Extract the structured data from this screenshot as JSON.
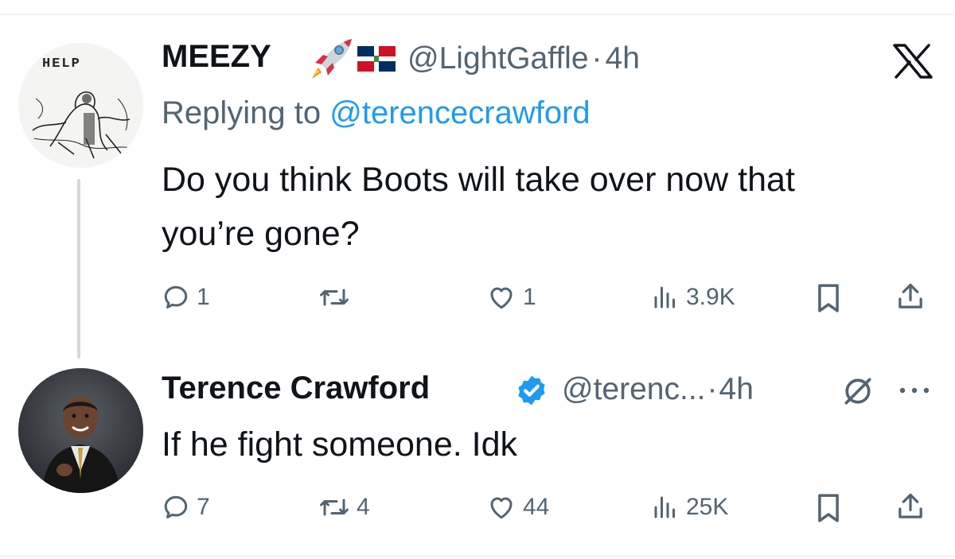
{
  "tweet1": {
    "avatar_text": "HELP",
    "display_name": "MEEZY",
    "handle": "@LightGaffle",
    "sep": "·",
    "time": "4h",
    "emoji_1": "rocket",
    "emoji_2": "dominican-flag",
    "replying_prefix": "Replying to",
    "replying_to": "@terencecrawford",
    "body_line1": "Do you think Boots will take over now that",
    "body_line2": "you’re gone?",
    "replies": "1",
    "retweets": "",
    "likes": "1",
    "views": "3.9K"
  },
  "tweet2": {
    "display_name": "Terence Crawford",
    "verified": true,
    "handle": "@terenc...",
    "sep": "·",
    "time": "4h",
    "body": "If he fight someone. Idk",
    "replies": "7",
    "retweets": "4",
    "likes": "44",
    "views": "25K"
  },
  "colors": {
    "text": "#0f1419",
    "muted": "#536471",
    "link": "#1d9bf0",
    "verified": "#1d9bf0"
  },
  "icons": [
    "x-logo-icon",
    "reply-icon",
    "retweet-icon",
    "like-icon",
    "views-icon",
    "bookmark-icon",
    "share-icon",
    "more-icon",
    "no-reply-icon"
  ]
}
